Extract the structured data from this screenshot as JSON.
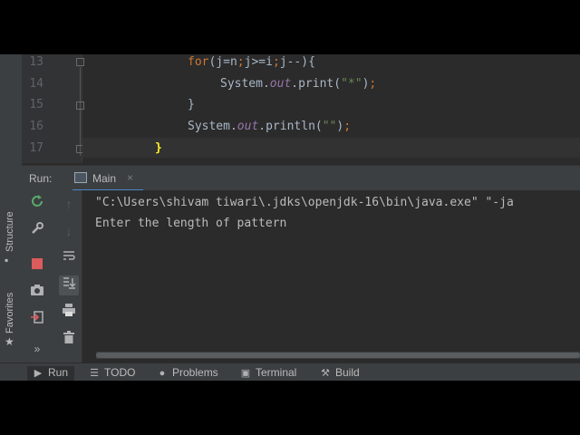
{
  "editor": {
    "lines": [
      {
        "num": "13"
      },
      {
        "num": "14"
      },
      {
        "num": "15"
      },
      {
        "num": "16"
      },
      {
        "num": "17"
      }
    ],
    "code": {
      "l13_kw": "for",
      "l13_rest_a": "(j=n",
      "l13_semi1": ";",
      "l13_rest_b": "j>=i",
      "l13_semi2": ";",
      "l13_rest_c": "j--){",
      "l14_a": "System.",
      "l14_field": "out",
      "l14_b": ".print(",
      "l14_str": "\"*\"",
      "l14_c": ")",
      "l14_semi": ";",
      "l15": "}",
      "l16_a": "System.",
      "l16_field": "out",
      "l16_b": ".println(",
      "l16_str": "\"\"",
      "l16_c": ")",
      "l16_semi": ";",
      "l17": "}"
    }
  },
  "run_panel": {
    "label": "Run:",
    "tab_label": "Main",
    "tab_close": "×",
    "console_lines": [
      "\"C:\\Users\\shivam tiwari\\.jdks\\openjdk-16\\bin\\java.exe\" \"-ja",
      "Enter the length of pattern"
    ]
  },
  "side_stripe": {
    "structure": "Structure",
    "favorites": "Favorites"
  },
  "bottom_bar": {
    "run": "Run",
    "todo": "TODO",
    "problems": "Problems",
    "terminal": "Terminal",
    "build": "Build"
  },
  "colors": {
    "keyword": "#cc7832",
    "string": "#6a8759",
    "field": "#9876aa",
    "text": "#a9b7c6",
    "rerun": "#59a869",
    "stop": "#db5c5c"
  }
}
